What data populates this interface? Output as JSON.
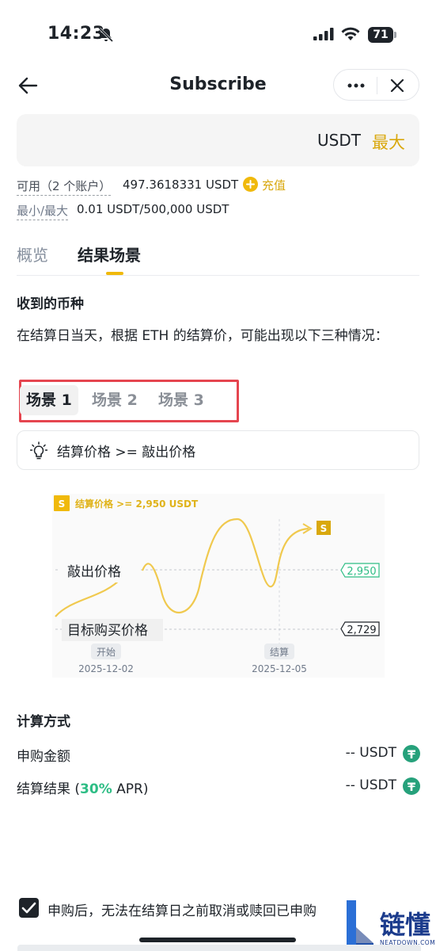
{
  "status_bar": {
    "time": "14:23",
    "battery": "71"
  },
  "header": {
    "title": "Subscribe"
  },
  "amount": {
    "unit": "USDT",
    "max_label": "最大"
  },
  "balance": {
    "available_label": "可用（2 个账户）",
    "available_value": "497.3618331 USDT",
    "topup_label": "充值",
    "limit_label": "最小/最大",
    "limit_value": "0.01 USDT/500,000 USDT"
  },
  "tabs": [
    {
      "label": "概览"
    },
    {
      "label": "结果场景"
    }
  ],
  "section": {
    "title": "收到的币种",
    "description": "在结算日当天，根据 ETH 的结算价，可能出现以下三种情况："
  },
  "scenario_tabs": [
    {
      "label": "场景 1"
    },
    {
      "label": "场景 2"
    },
    {
      "label": "场景 3"
    }
  ],
  "condition": "结算价格 >= 敲出价格",
  "chart": {
    "legend_badge": "S",
    "legend_text": "结算价格 >= 2,950 USDT",
    "end_badge": "S",
    "knockout_label": "敲出价格",
    "knockout_value": "2,950",
    "target_label": "目标购买价格",
    "target_value": "2,729",
    "start_label": "开始",
    "start_date": "2025-12-02",
    "settle_label": "结算",
    "settle_date": "2025-12-05"
  },
  "chart_data": {
    "type": "line",
    "series": [],
    "reference_lines": [
      {
        "label": "敲出价格",
        "value": 2950
      },
      {
        "label": "目标购买价格",
        "value": 2729
      }
    ],
    "x_markers": [
      {
        "label": "开始",
        "date": "2025-12-02"
      },
      {
        "label": "结算",
        "date": "2025-12-05"
      }
    ],
    "annotation": "结算价格 >= 2,950 USDT",
    "colors": {
      "line": "#f0b90b",
      "knockout": "#2ebd85",
      "target": "#1e2329"
    }
  },
  "calc": {
    "title": "计算方式",
    "rows": [
      {
        "label_prefix": "申购金额",
        "apr": "",
        "label_suffix": "",
        "value": "-- USDT"
      },
      {
        "label_prefix": "结算结果 (",
        "apr": "30%",
        "label_suffix": " APR)",
        "value": "-- USDT"
      }
    ]
  },
  "footer": {
    "agreement": "申购后，无法在结算日之前取消或赎回已申购"
  },
  "colors": {
    "accent": "#f0b90b",
    "accent_text": "#d9a80d",
    "green": "#2ebd85",
    "red_outline": "#e5454f"
  }
}
